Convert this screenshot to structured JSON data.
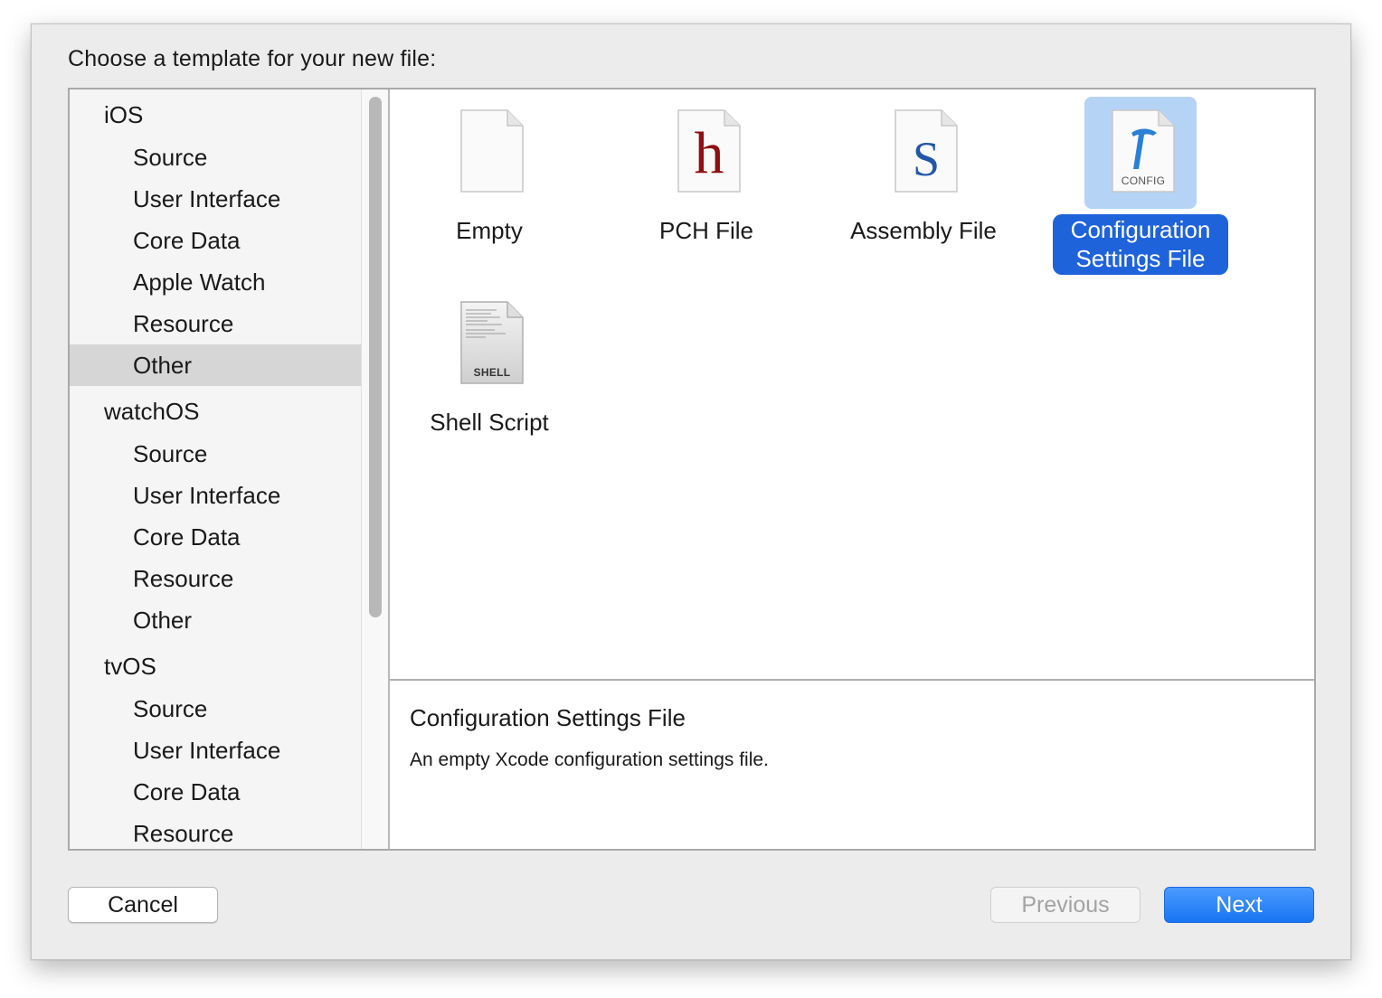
{
  "dialog": {
    "prompt": "Choose a template for your new file:"
  },
  "sidebar": {
    "groups": [
      {
        "title": "iOS",
        "items": [
          "Source",
          "User Interface",
          "Core Data",
          "Apple Watch",
          "Resource",
          "Other"
        ]
      },
      {
        "title": "watchOS",
        "items": [
          "Source",
          "User Interface",
          "Core Data",
          "Resource",
          "Other"
        ]
      },
      {
        "title": "tvOS",
        "items": [
          "Source",
          "User Interface",
          "Core Data",
          "Resource"
        ]
      }
    ],
    "selected": {
      "group": "iOS",
      "item": "Other"
    }
  },
  "templates": [
    {
      "label": "Empty",
      "icon": "empty-document-icon"
    },
    {
      "label": "PCH File",
      "icon": "pch-file-icon",
      "glyph": "h"
    },
    {
      "label": "Assembly File",
      "icon": "assembly-file-icon",
      "glyph": "S"
    },
    {
      "label": "Configuration Settings File",
      "label_line1": "Configuration",
      "label_line2": "Settings File",
      "icon": "config-file-icon",
      "caption": "CONFIG",
      "selected": true
    },
    {
      "label": "Shell Script",
      "icon": "shell-script-icon",
      "caption": "SHELL"
    }
  ],
  "description": {
    "title": "Configuration Settings File",
    "text": "An empty Xcode configuration settings file."
  },
  "buttons": {
    "cancel": "Cancel",
    "previous": "Previous",
    "next": "Next"
  },
  "colors": {
    "selection_blue": "#1f63db",
    "selection_icon_bg": "#b5d3f5",
    "next_button": "#1874f2",
    "pch_glyph": "#8e1010",
    "assembly_glyph": "#2356a8",
    "config_glyph": "#2a7fd6"
  }
}
